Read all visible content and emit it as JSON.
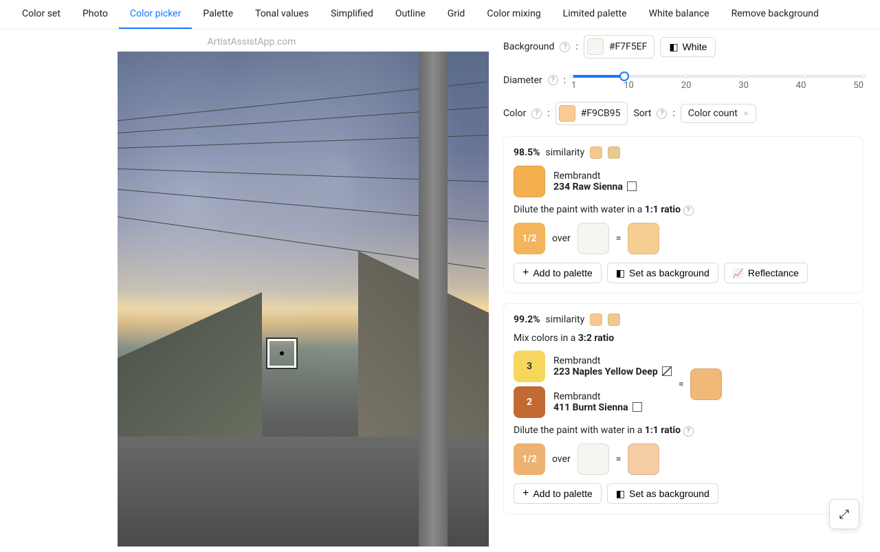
{
  "watermark": "ArtistAssistApp.com",
  "tabs": [
    "Color set",
    "Photo",
    "Color picker",
    "Palette",
    "Tonal values",
    "Simplified",
    "Outline",
    "Grid",
    "Color mixing",
    "Limited palette",
    "White balance",
    "Remove background"
  ],
  "active_tab": "Color picker",
  "background": {
    "label": "Background",
    "hex": "#F7F5EF",
    "white_button": "White"
  },
  "diameter": {
    "label": "Diameter",
    "value": 10,
    "marks": [
      "1",
      "10",
      "20",
      "30",
      "40",
      "50"
    ]
  },
  "color": {
    "label": "Color",
    "hex": "#F9CB95",
    "swatch": "#F9CB95"
  },
  "sort": {
    "label": "Sort",
    "value": "Color count"
  },
  "cards": [
    {
      "similarity": "98.5%",
      "sim_label": "similarity",
      "sw1": "#F6C88E",
      "sw2": "#E9CA8E",
      "paint_swatch": "#F4B04E",
      "brand": "Rembrandt",
      "name": "234 Raw Sienna",
      "checkbox": "plain",
      "dilute_prefix": "Dilute the paint with water in a ",
      "dilute_ratio": "1:1 ratio",
      "frac": "1/2",
      "frac_bg": "#F3B45B",
      "over": "over",
      "over_sw": "#F7F5EF",
      "eq": "=",
      "result_sw": "#F7CE91",
      "add": "Add to palette",
      "setbg": "Set as background",
      "refl": "Reflectance"
    },
    {
      "similarity": "99.2%",
      "sim_label": "similarity",
      "sw1": "#F6C893",
      "sw2": "#EACB91",
      "mix_text_prefix": "Mix colors in a ",
      "mix_ratio": "3:2 ratio",
      "parts": [
        {
          "n": "3",
          "bg": "#F6D75E",
          "brand": "Rembrandt",
          "name": "223 Naples Yellow Deep",
          "checkbox": "striped"
        },
        {
          "n": "2",
          "bg": "#C26A32",
          "brand": "Rembrandt",
          "name": "411 Burnt Sienna",
          "checkbox": "plain"
        }
      ],
      "mix_result_sw": "#F1B877",
      "eq": "=",
      "dilute_prefix": "Dilute the paint with water in a ",
      "dilute_ratio": "1:1 ratio",
      "frac": "1/2",
      "frac_bg": "#EDB272",
      "over": "over",
      "over_sw": "#F7F5EF",
      "eq2": "=",
      "result_sw": "#F5CDA2",
      "add": "Add to palette",
      "setbg": "Set as background"
    }
  ]
}
